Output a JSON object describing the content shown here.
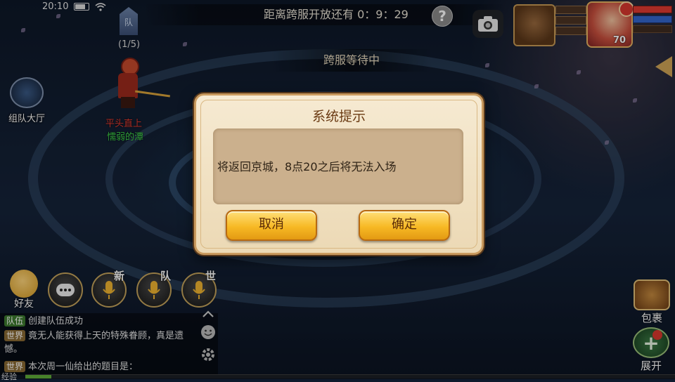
{
  "status_bar": {
    "time": "20:10"
  },
  "top_bar": {
    "countdown_label": "距离跨服开放还有",
    "countdown_value": "0：9：29",
    "help_label": "?"
  },
  "waiting_banner": "跨服等待中",
  "party": {
    "count": "(1/5)"
  },
  "player_character": {
    "title": "平头直上",
    "name": "懦弱的潭"
  },
  "left_menu": {
    "team_hall_label": "组队大厅"
  },
  "player_status": {
    "level": "70"
  },
  "chat": {
    "friends_label": "好友",
    "channel_tags": [
      "新",
      "队",
      "世"
    ],
    "messages": [
      {
        "channel": "队伍",
        "text": "创建队伍成功"
      },
      {
        "channel": "世界",
        "text": "竟无人能获得上天的特殊眷顾，真是遗憾。"
      },
      {
        "channel": "世界",
        "text": "本次周一仙给出的题目是："
      }
    ],
    "exp_label": "经验"
  },
  "right_menu": {
    "bag_label": "包裹",
    "expand_label": "展开"
  },
  "dialog": {
    "title": "系统提示",
    "message": "将返回京城，8点20之后将无法入场",
    "cancel_label": "取消",
    "confirm_label": "确定"
  },
  "colors": {
    "accent_gold": "#f7b925",
    "dialog_bg": "#f6ead2",
    "hp": "#e03a30",
    "mp": "#3366cc"
  },
  "icons": [
    "wifi-icon",
    "battery-icon",
    "camera-icon",
    "help-icon",
    "voice-mic-icon",
    "chat-bubble-icon",
    "emoji-icon",
    "settings-icon",
    "chevron-up-icon"
  ]
}
